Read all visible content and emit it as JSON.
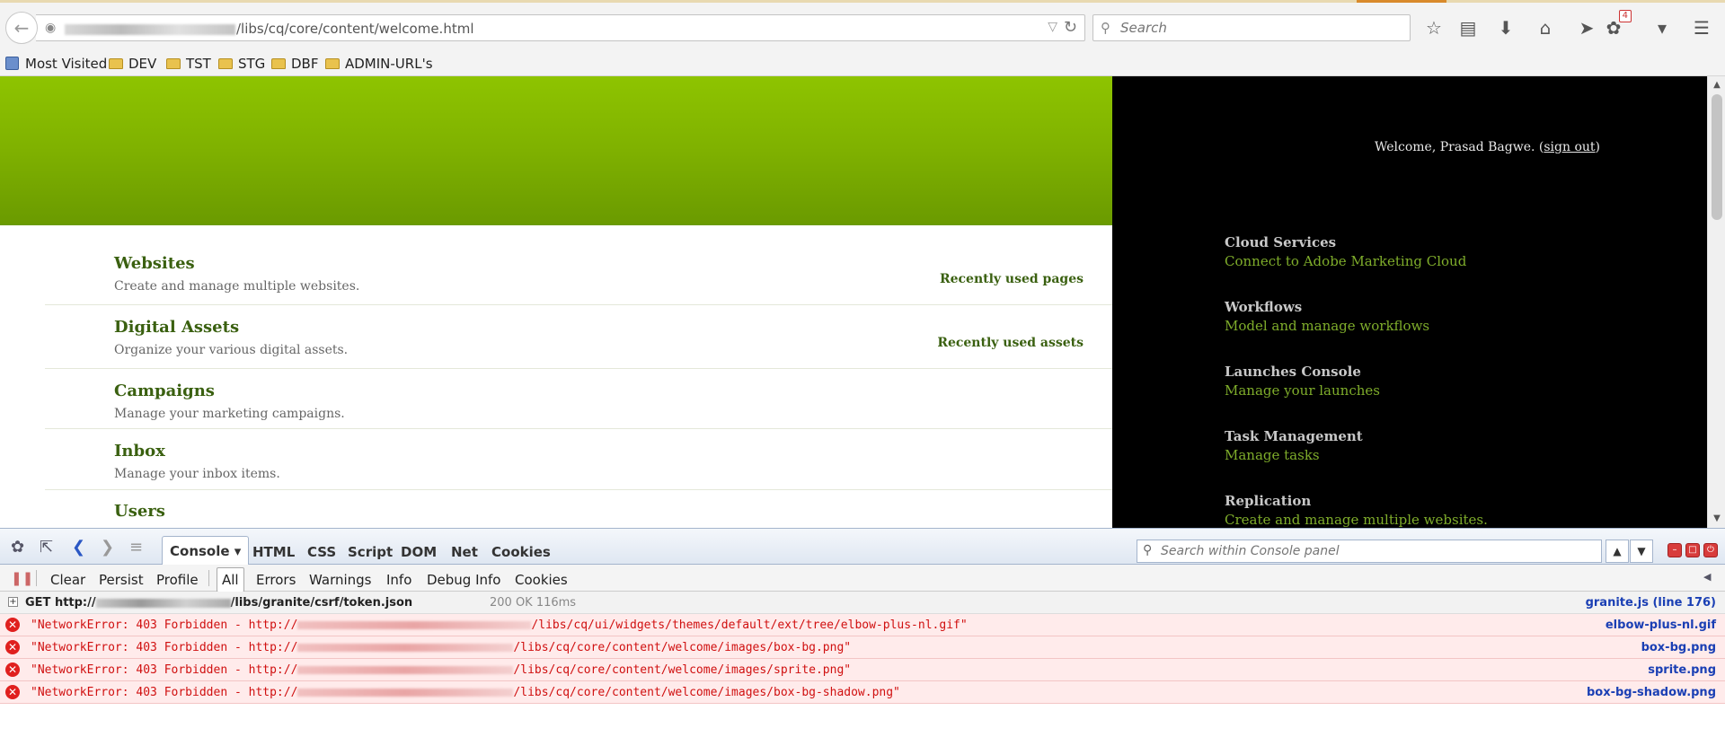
{
  "browser": {
    "url_path": "/libs/cq/core/content/welcome.html",
    "search_placeholder": "Search",
    "notification_count": "4"
  },
  "bookmarks": [
    "Most Visited",
    "DEV",
    "TST",
    "STG",
    "DBF",
    "ADMIN-URL's"
  ],
  "left": {
    "sections": [
      {
        "title": "Websites",
        "desc": "Create and manage multiple websites.",
        "link": "Recently used pages"
      },
      {
        "title": "Digital Assets",
        "desc": "Organize your various digital assets.",
        "link": "Recently used assets"
      },
      {
        "title": "Campaigns",
        "desc": "Manage your marketing campaigns.",
        "link": ""
      },
      {
        "title": "Inbox",
        "desc": "Manage your inbox items.",
        "link": ""
      },
      {
        "title": "Users",
        "desc": "",
        "link": ""
      }
    ]
  },
  "right": {
    "welcome_prefix": "Welcome, Prasad Bagwe. (",
    "sign_out": "sign out",
    "welcome_suffix": ")",
    "items": [
      {
        "title": "Cloud Services",
        "link": "Connect to Adobe Marketing Cloud"
      },
      {
        "title": "Workflows",
        "link": "Model and manage workflows"
      },
      {
        "title": "Launches Console",
        "link": "Manage your launches"
      },
      {
        "title": "Task Management",
        "link": "Manage tasks"
      },
      {
        "title": "Replication",
        "link": "Create and manage multiple websites."
      }
    ]
  },
  "firebug": {
    "tabs": [
      "Console",
      "HTML",
      "CSS",
      "Script",
      "DOM",
      "Net",
      "Cookies"
    ],
    "search_placeholder": "Search within Console panel",
    "sub": [
      "Clear",
      "Persist",
      "Profile",
      "All",
      "Errors",
      "Warnings",
      "Info",
      "Debug Info",
      "Cookies"
    ],
    "get_row": {
      "method": "GET http://",
      "path": "/libs/granite/csrf/token.json",
      "status": "200 OK 116ms",
      "source": "granite.js (line 176)"
    },
    "errors": [
      {
        "prefix": "\"NetworkError: 403 Forbidden - http://",
        "suffix": "/libs/cq/ui/widgets/themes/default/ext/tree/elbow-plus-nl.gif\"",
        "source": "elbow-plus-nl.gif"
      },
      {
        "prefix": "\"NetworkError: 403 Forbidden - http://",
        "suffix": "/libs/cq/core/content/welcome/images/box-bg.png\"",
        "source": "box-bg.png"
      },
      {
        "prefix": "\"NetworkError: 403 Forbidden - http://",
        "suffix": "/libs/cq/core/content/welcome/images/sprite.png\"",
        "source": "sprite.png"
      },
      {
        "prefix": "\"NetworkError: 403 Forbidden - http://",
        "suffix": "/libs/cq/core/content/welcome/images/box-bg-shadow.png\"",
        "source": "box-bg-shadow.png"
      }
    ]
  }
}
